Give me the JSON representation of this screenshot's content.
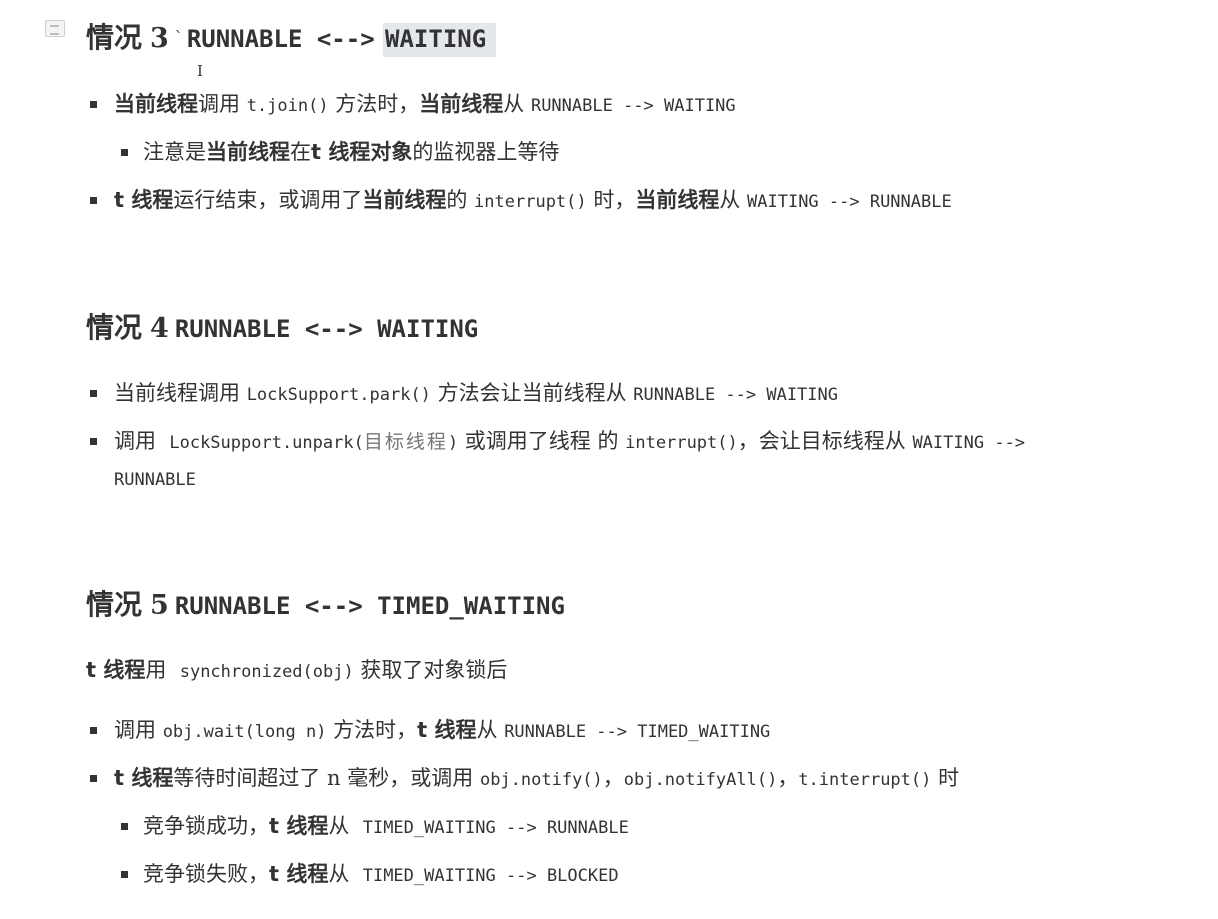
{
  "s3": {
    "h_cn": "情况",
    "h_num": "3",
    "h_tick": "`",
    "h_a": "RUNNABLE <-->",
    "h_b": "WAITING",
    "b1": {
      "bold1": "当前线程",
      "t1": "调用",
      "code1": "t.join()",
      "t2": "方法时，",
      "bold2": "当前线程",
      "t3": "从",
      "code2": "RUNNABLE --> WAITING"
    },
    "b1_sub": {
      "t1": "注意是",
      "bold1": "当前线程",
      "t2": "在",
      "bold2": "t 线程对象",
      "t3": "的监视器上等待"
    },
    "b2": {
      "bold1": "t 线程",
      "t1": "运行结束，或调用了",
      "bold2": "当前线程",
      "t2": "的",
      "code1": "interrupt()",
      "t3": "时，",
      "bold3": "当前线程",
      "t4": "从",
      "code2": "WAITING --> RUNNABLE"
    }
  },
  "s4": {
    "h_cn": "情况",
    "h_num": "4",
    "h_a": "RUNNABLE <--> WAITING",
    "b1": {
      "t1": "当前线程调用",
      "code1": "LockSupport.park()",
      "t2": "方法会让当前线程从",
      "code2": "RUNNABLE --> WAITING"
    },
    "b2": {
      "t1": "调用",
      "code1": "LockSupport.unpark(",
      "ph": "目标线程",
      "code2": ")",
      "t2": "或调用了线程 的",
      "code3": "interrupt()",
      "t3": "，会让目标线程从",
      "code4": "WAITING -->",
      "code5": "RUNNABLE"
    }
  },
  "s5": {
    "h_cn": "情况",
    "h_num": "5",
    "h_a": "RUNNABLE <--> TIMED_WAITING",
    "intro": {
      "bold1": "t 线程",
      "t1": "用",
      "code1": "synchronized(obj)",
      "t2": "获取了对象锁后"
    },
    "b1": {
      "t1": "调用",
      "code1": "obj.wait(long n)",
      "t2": "方法时，",
      "bold1": "t 线程",
      "t3": "从",
      "code2": "RUNNABLE --> TIMED_WAITING"
    },
    "b2": {
      "bold1": "t 线程",
      "t1": "等待时间超过了",
      "n": "n",
      "t2": "毫秒，或调用",
      "code1": "obj.notify()",
      "t3": "，",
      "code2": "obj.notifyAll()",
      "t4": "，",
      "code3": "t.interrupt()",
      "t5": "时"
    },
    "b2_sub1": {
      "t1": "竞争锁成功，",
      "bold1": "t 线程",
      "t2": "从",
      "code1": "TIMED_WAITING --> RUNNABLE"
    },
    "b2_sub2": {
      "t1": "竞争锁失败，",
      "bold1": "t 线程",
      "t2": "从",
      "code1": "TIMED_WAITING --> BLOCKED"
    }
  }
}
